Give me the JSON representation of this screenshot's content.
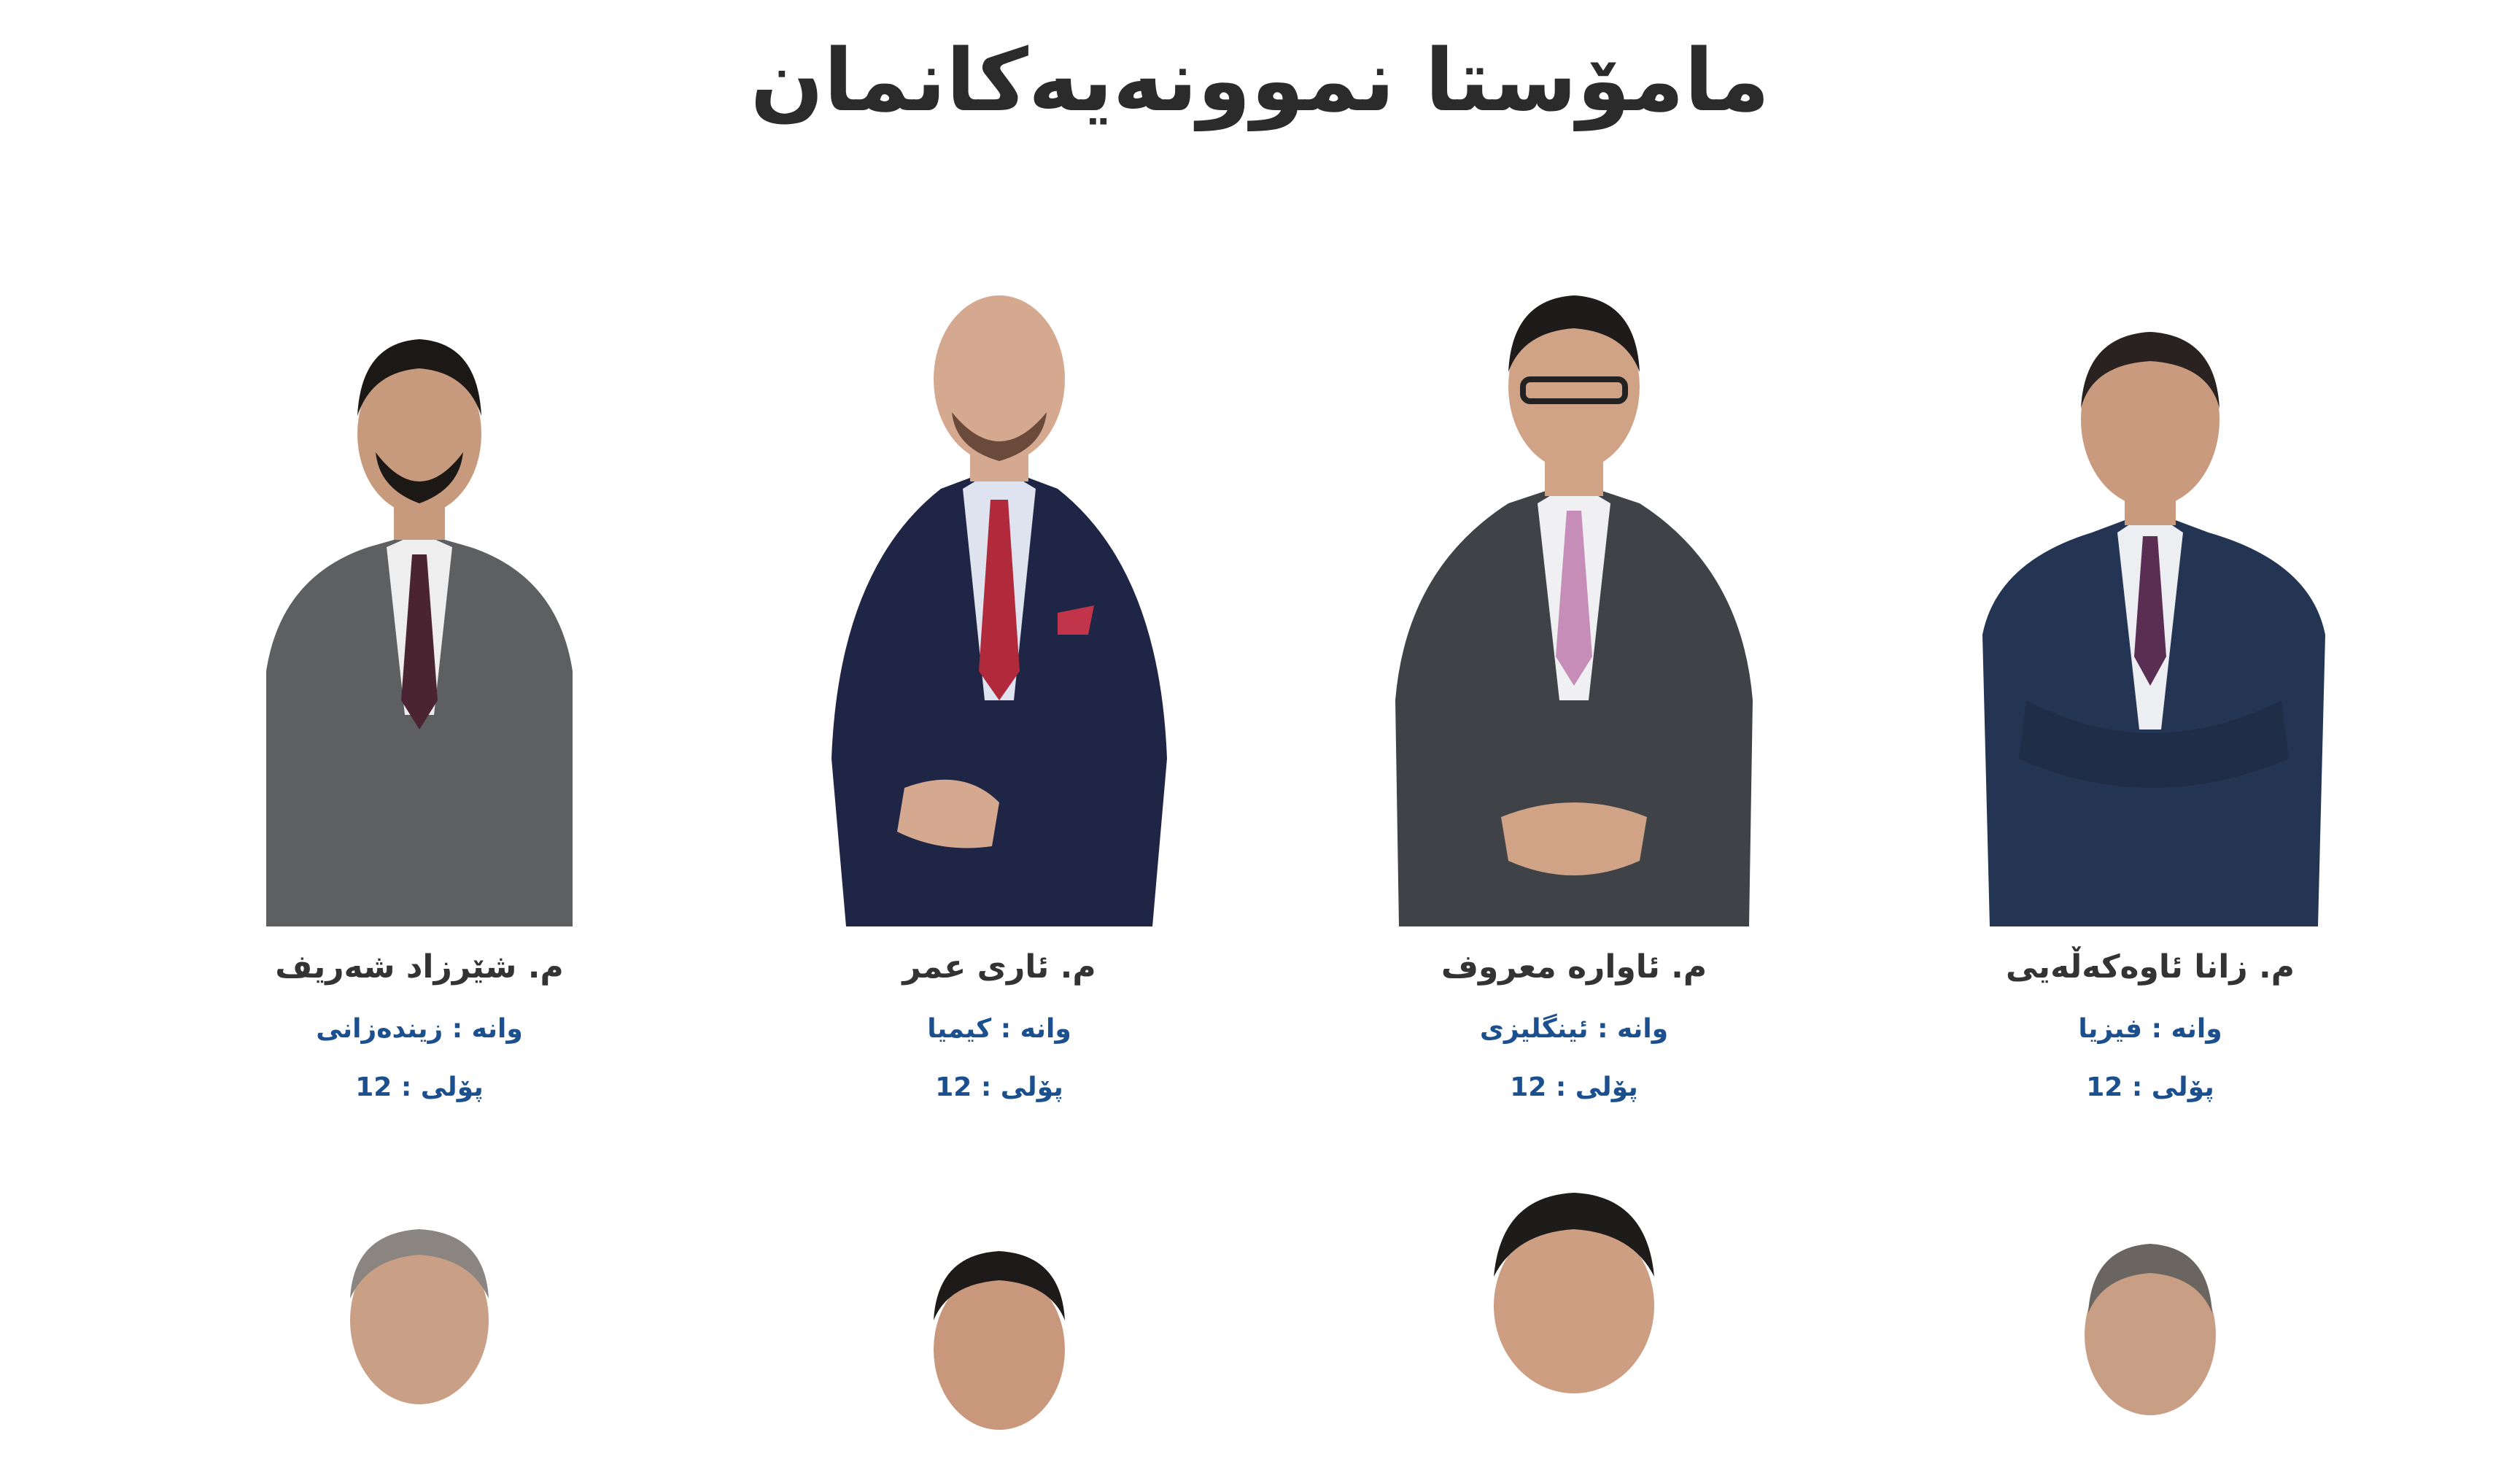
{
  "page": {
    "title": "مامۆستا نموونەیەکانمان"
  },
  "teachers": [
    {
      "name": "م. زانا ئاوەکەڵەیی",
      "subject": "وانە : فیزیا",
      "grade": "پۆلی : 12",
      "colors": {
        "suit": "#243553",
        "tie": "#5a2e52",
        "skin": "#c99a7e",
        "hair": "#2a2220"
      }
    },
    {
      "name": "م. ئاوارە معروف",
      "subject": "وانە : ئینگلیزی",
      "grade": "پۆلی : 12",
      "colors": {
        "suit": "#3f4347",
        "tie": "#c68db9",
        "skin": "#d0a387",
        "hair": "#1e1b1a"
      }
    },
    {
      "name": "م. ئاری عمر",
      "subject": "وانە : کیمیا",
      "grade": "پۆلی : 12",
      "colors": {
        "suit": "#1f2544",
        "tie": "#b02a3c",
        "skin": "#d4a98f",
        "hair": "#6a4a3a"
      }
    },
    {
      "name": "م. شێرزاد شەریف",
      "subject": "وانە : زیندەزانی",
      "grade": "پۆلی : 12",
      "colors": {
        "suit": "#5d5f61",
        "tie": "#4a2430",
        "skin": "#c79a7e",
        "hair": "#1c1816"
      }
    }
  ],
  "teachers_row2": [
    {
      "colors": {
        "hair": "#8a8580",
        "skin": "#c99f86"
      }
    },
    {
      "colors": {
        "hair": "#1d1a19",
        "skin": "#c9987c"
      }
    },
    {
      "colors": {
        "hair": "#1e1c1b",
        "skin": "#cd9e82"
      }
    },
    {
      "colors": {
        "hair": "#6a6561",
        "skin": "#c89e85"
      }
    }
  ]
}
